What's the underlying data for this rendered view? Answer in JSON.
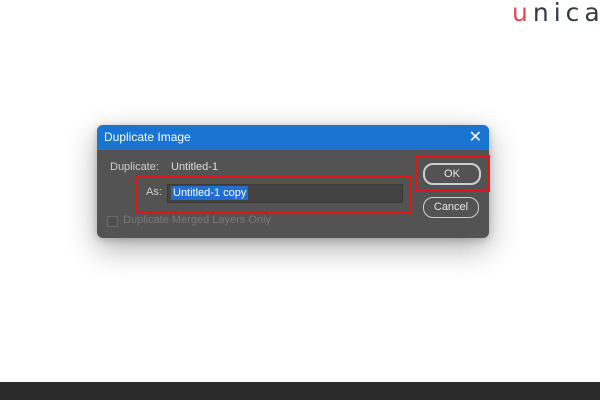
{
  "brand": {
    "logo_left": "u",
    "logo_right": "nica"
  },
  "dialog": {
    "title": "Duplicate Image",
    "close_icon": "close-icon",
    "duplicate_label": "Duplicate:",
    "duplicate_value": "Untitled-1",
    "as_label": "As:",
    "as_value": "Untitled-1 copy",
    "checkbox_label": "Duplicate Merged Layers Only",
    "checkbox_checked": false,
    "checkbox_enabled": false,
    "ok_label": "OK",
    "cancel_label": "Cancel"
  },
  "colors": {
    "titlebar": "#1a74d1",
    "dialog_bg": "#535353",
    "highlight_box": "#e2141a",
    "brand_accent": "#e8484f"
  }
}
